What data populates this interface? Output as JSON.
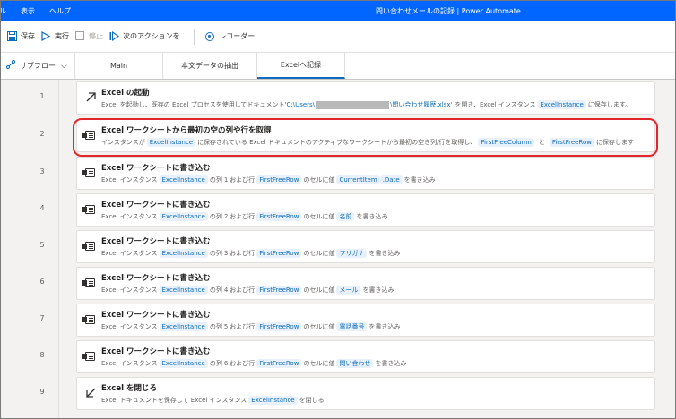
{
  "titlebar": {
    "menus": [
      "ル",
      "表示",
      "ヘルプ"
    ],
    "title": "問い合わせメールの記録 | Power Automate"
  },
  "toolbar": {
    "save": "保存",
    "run": "実行",
    "stop": "停止",
    "next_action": "次のアクションを...",
    "recorder": "レコーダー"
  },
  "tabs": {
    "subflow": "サブフロー",
    "items": [
      "Main",
      "本文データの抽出",
      "Excelへ記録"
    ],
    "active_index": 2
  },
  "actions": [
    {
      "num": "1",
      "icon": "launch-arrow-icon",
      "title": "Excel の起動",
      "desc": {
        "pre": "Excel を起動し、既存の Excel プロセスを使用してドキュメント",
        "path_start": "'C:\\Users\\",
        "path_end": "\\問い合わせ履歴.xlsx'",
        "mid": "を開き、Excel インスタンス",
        "var": "ExcelInstance",
        "post": "に保存します。"
      }
    },
    {
      "num": "2",
      "icon": "excel-icon",
      "title": "Excel ワークシートから最初の空の列や行を取得",
      "desc": {
        "pre": "インスタンスが",
        "var1": "ExcelInstance",
        "mid": "に保存されている Excel ドキュメントのアクティブなワークシートから最初の空き列/行を取得し、",
        "var2": "FirstFreeColumn",
        "and": "と",
        "var3": "FirstFreeRow",
        "post": "に保存します"
      }
    },
    {
      "num": "3",
      "icon": "excel-icon",
      "title": "Excel ワークシートに書き込む",
      "desc": {
        "instance": "ExcelInstance",
        "col": "1",
        "row_var": "FirstFreeRow",
        "value": "CurrentItem",
        "suffix": ".Date"
      }
    },
    {
      "num": "4",
      "icon": "excel-icon",
      "title": "Excel ワークシートに書き込む",
      "desc": {
        "instance": "ExcelInstance",
        "col": "2",
        "row_var": "FirstFreeRow",
        "value": "名前",
        "suffix": ""
      }
    },
    {
      "num": "5",
      "icon": "excel-icon",
      "title": "Excel ワークシートに書き込む",
      "desc": {
        "instance": "ExcelInstance",
        "col": "3",
        "row_var": "FirstFreeRow",
        "value": "フリガナ",
        "suffix": ""
      }
    },
    {
      "num": "6",
      "icon": "excel-icon",
      "title": "Excel ワークシートに書き込む",
      "desc": {
        "instance": "ExcelInstance",
        "col": "4",
        "row_var": "FirstFreeRow",
        "value": "メール",
        "suffix": ""
      }
    },
    {
      "num": "7",
      "icon": "excel-icon",
      "title": "Excel ワークシートに書き込む",
      "desc": {
        "instance": "ExcelInstance",
        "col": "5",
        "row_var": "FirstFreeRow",
        "value": "電話番号",
        "suffix": ""
      }
    },
    {
      "num": "8",
      "icon": "excel-icon",
      "title": "Excel ワークシートに書き込む",
      "desc": {
        "instance": "ExcelInstance",
        "col": "6",
        "row_var": "FirstFreeRow",
        "value": "問い合わせ",
        "suffix": ""
      }
    },
    {
      "num": "9",
      "icon": "close-arrow-icon",
      "title": "Excel を閉じる",
      "desc": {
        "pre": "Excel ドキュメントを保存して Excel インスタンス",
        "var": "ExcelInstance",
        "post": "を閉じる"
      }
    }
  ],
  "write_template": {
    "p1": "Excel インスタンス",
    "p2": "の列",
    "p3": "および行",
    "p4": "のセルに値",
    "p5": "を書き込み"
  },
  "colors": {
    "titlebar": "#0066ff",
    "accent": "#0f6cbd",
    "highlight": "#e3262b"
  }
}
